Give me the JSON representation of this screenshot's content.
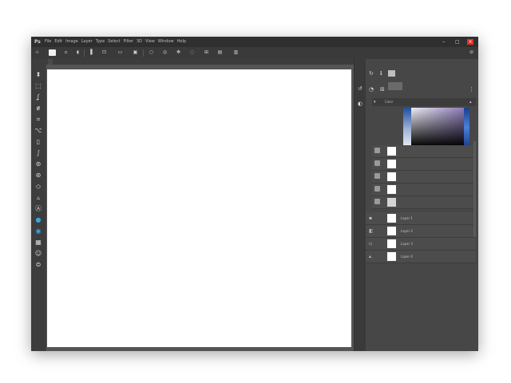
{
  "app": {
    "logo": "Ps",
    "menu": [
      "File",
      "Edit",
      "Image",
      "Layer",
      "Type",
      "Select",
      "Filter",
      "3D",
      "View",
      "Window",
      "Help"
    ],
    "window_controls": {
      "minimize": "–",
      "maximize": "□",
      "close": "×"
    }
  },
  "options_bar": {
    "icons": [
      "move-tool-icon",
      "artboard-icon",
      "auto-select-icon",
      "transform-icon",
      "align-left-icon",
      "align-center-icon",
      "align-right-icon",
      "distribute-icon",
      "3d-mode-icon",
      "orbit-icon",
      "pan-icon",
      "slide-icon",
      "scale-icon",
      "video-icon",
      "more-icon"
    ],
    "right_icons": [
      "search-icon",
      "workspace-icon"
    ]
  },
  "document_tab": {
    "label": ""
  },
  "tools": [
    "move-icon",
    "marquee-icon",
    "lasso-icon",
    "quick-select-icon",
    "crop-icon",
    "eyedropper-icon",
    "healing-icon",
    "brush-icon",
    "clone-icon",
    "history-brush-icon",
    "eraser-icon",
    "gradient-icon",
    "blur-icon",
    "dodge-icon",
    "pen-icon",
    "type-icon",
    "path-select-icon",
    "shape-icon"
  ],
  "panels": {
    "top_icons": [
      "history-icon",
      "properties-icon"
    ],
    "color_header": {
      "tab": "Color"
    },
    "rows": [
      {
        "label": "",
        "thumb": "white"
      },
      {
        "label": "",
        "thumb": "white"
      },
      {
        "label": "",
        "thumb": "white"
      },
      {
        "label": "",
        "thumb": "white"
      },
      {
        "label": "",
        "thumb": "grey"
      },
      {
        "label": "Layer 1",
        "thumb": "white"
      },
      {
        "label": "Layer 2",
        "thumb": "white"
      },
      {
        "label": "Layer 3",
        "thumb": "white"
      },
      {
        "label": "Layer 4",
        "thumb": "white"
      }
    ]
  },
  "colors": {
    "window_bg": "#424242",
    "titlebar": "#2f2f2f",
    "canvas": "#ffffff",
    "accent_blue": "#1f4fa0",
    "close_red": "#d9342b"
  }
}
